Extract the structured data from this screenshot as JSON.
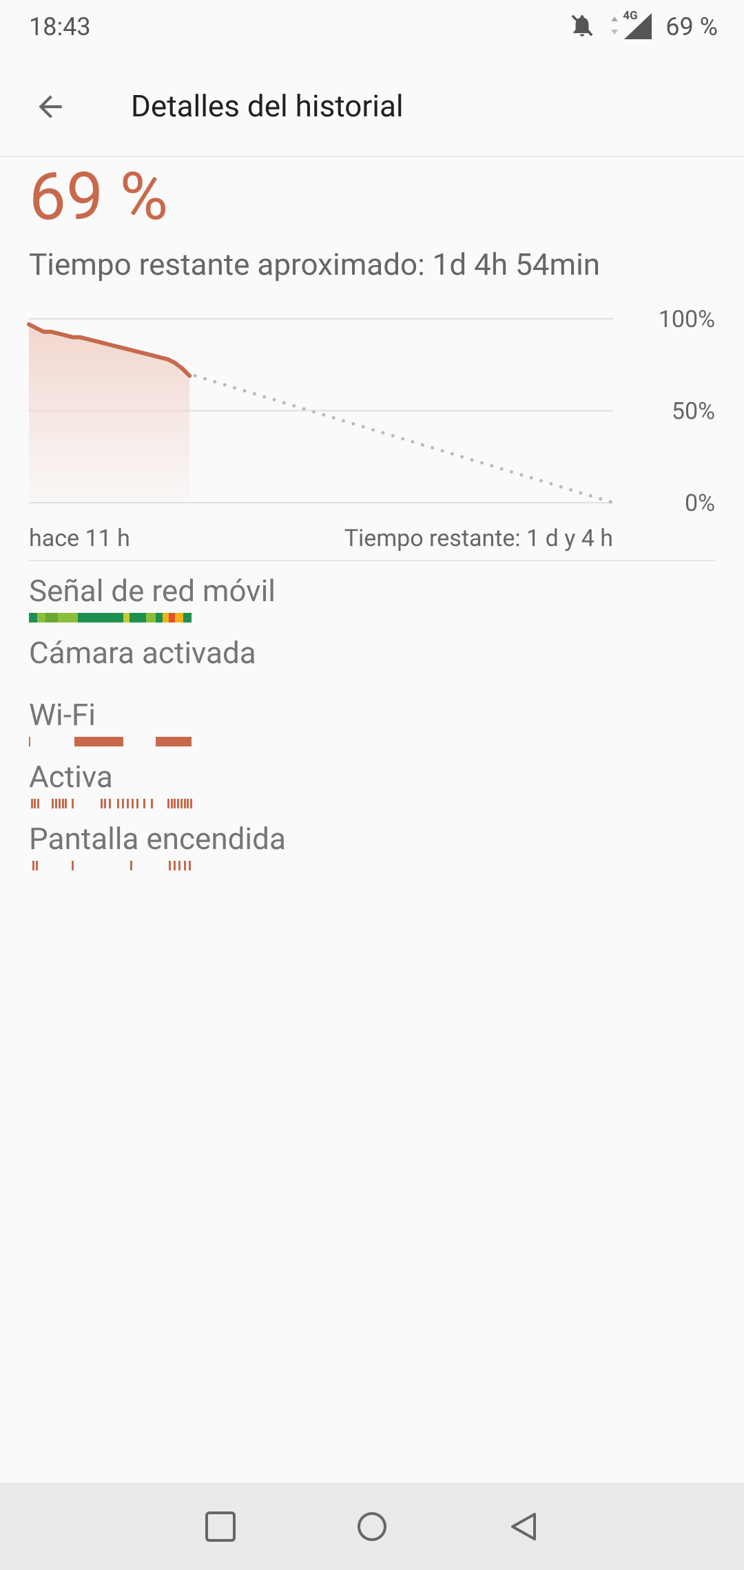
{
  "status_bar": {
    "time": "18:43",
    "network": "4G",
    "battery": "69 %",
    "icons": [
      "notifications-off-icon",
      "data-arrows-icon",
      "cell-signal-icon"
    ]
  },
  "app_bar": {
    "title": "Detalles del historial",
    "back_icon": "arrow-back-icon"
  },
  "battery": {
    "percent": "69 %",
    "remaining": "Tiempo restante aproximado: 1d 4h 54min"
  },
  "chart_data": {
    "type": "line",
    "x_labels": {
      "start": "hace 11 h",
      "end": "Tiempo restante: 1 d y 4 h"
    },
    "y_ticks": [
      "100%",
      "50%",
      "0%"
    ],
    "ylim": [
      0,
      100
    ],
    "series": [
      {
        "kind": "history",
        "x": [
          0,
          0.5,
          1,
          1.5,
          2,
          2.5,
          3,
          3.5,
          4,
          4.5,
          5,
          5.5,
          6,
          6.5,
          7,
          7.5,
          8,
          8.5,
          9,
          9.5,
          10,
          10.5,
          11
        ],
        "values": [
          97,
          95,
          93,
          93,
          92,
          91,
          90,
          90,
          89,
          88,
          87,
          86,
          85,
          84,
          83,
          82,
          81,
          80,
          79,
          78,
          76,
          73,
          69
        ]
      },
      {
        "kind": "projection",
        "style": "dotted",
        "x": [
          11,
          40
        ],
        "values": [
          69,
          0
        ]
      }
    ],
    "grid": true,
    "colors": {
      "line": "#c8694b",
      "fill": "#f4dcd6",
      "projection": "#b0bfbf",
      "grid": "#e0e0e0"
    }
  },
  "rows": [
    {
      "label": "Señal de red móvil",
      "kind": "signal",
      "segments": [
        {
          "from": 0.0,
          "to": 0.05,
          "color": "#1e8f4e"
        },
        {
          "from": 0.05,
          "to": 0.1,
          "color": "#8bbf3b"
        },
        {
          "from": 0.1,
          "to": 0.18,
          "color": "#6aa832"
        },
        {
          "from": 0.18,
          "to": 0.3,
          "color": "#8bbf3b"
        },
        {
          "from": 0.3,
          "to": 0.58,
          "color": "#1e8f4e"
        },
        {
          "from": 0.58,
          "to": 0.62,
          "color": "#c9c934"
        },
        {
          "from": 0.62,
          "to": 0.72,
          "color": "#1e8f4e"
        },
        {
          "from": 0.72,
          "to": 0.78,
          "color": "#8bbf3b"
        },
        {
          "from": 0.78,
          "to": 0.82,
          "color": "#1e8f4e"
        },
        {
          "from": 0.82,
          "to": 0.86,
          "color": "#f2b01e"
        },
        {
          "from": 0.86,
          "to": 0.9,
          "color": "#e0552a"
        },
        {
          "from": 0.9,
          "to": 0.95,
          "color": "#f2b01e"
        },
        {
          "from": 0.95,
          "to": 1.0,
          "color": "#1e8f4e"
        }
      ]
    },
    {
      "label": "Cámara activada",
      "kind": "none",
      "segments": []
    },
    {
      "label": "Wi-Fi",
      "kind": "bar",
      "color": "#c8694b",
      "segments": [
        {
          "from": 0.0,
          "to": 0.01
        },
        {
          "from": 0.28,
          "to": 0.58
        },
        {
          "from": 0.78,
          "to": 1.0
        }
      ]
    },
    {
      "label": "Activa",
      "kind": "ticks",
      "color": "#c8694b",
      "ticks": [
        0.02,
        0.04,
        0.06,
        0.15,
        0.17,
        0.19,
        0.21,
        0.23,
        0.27,
        0.45,
        0.47,
        0.5,
        0.55,
        0.58,
        0.61,
        0.64,
        0.67,
        0.71,
        0.76,
        0.86,
        0.88,
        0.9,
        0.92,
        0.94,
        0.96,
        0.98,
        1.0
      ]
    },
    {
      "label": "Pantalla encendida",
      "kind": "ticks",
      "color": "#c8694b",
      "ticks": [
        0.03,
        0.05,
        0.27,
        0.63,
        0.87,
        0.9,
        0.93,
        0.96,
        0.99
      ]
    }
  ],
  "nav_bar": {
    "items": [
      "recents-square-icon",
      "home-circle-icon",
      "back-triangle-icon"
    ]
  }
}
